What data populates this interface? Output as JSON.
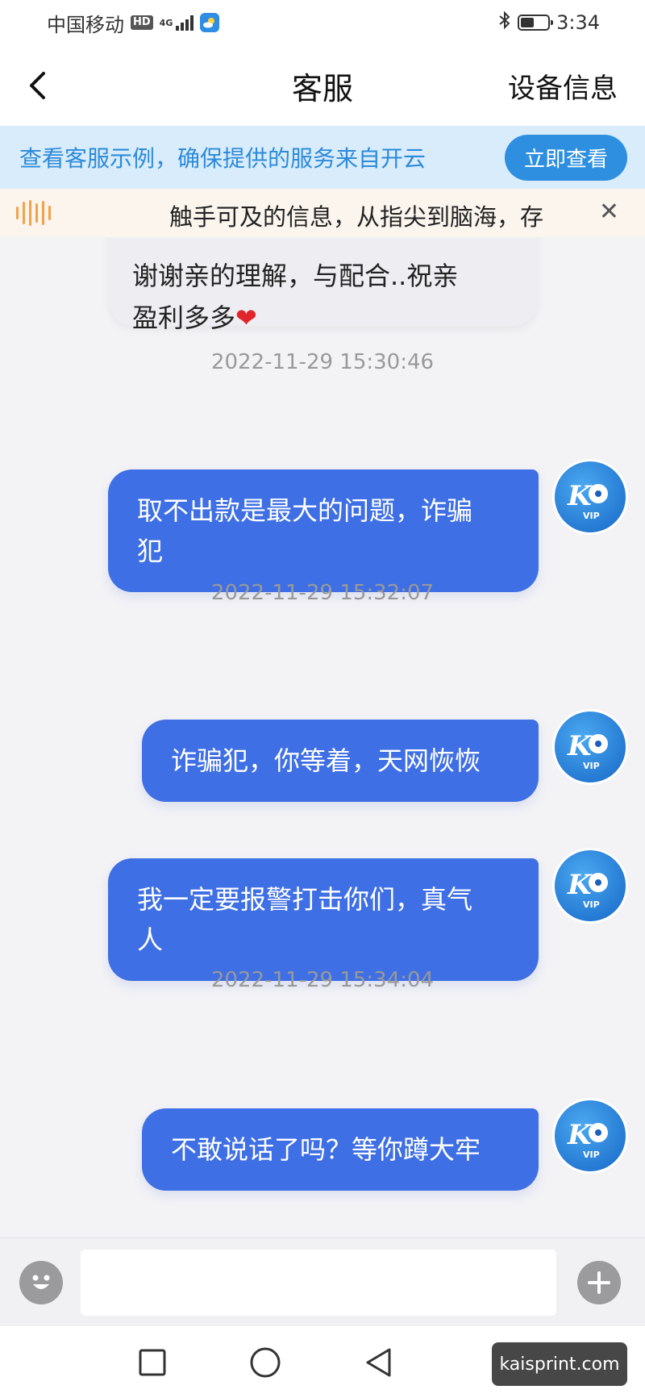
{
  "status_bar": {
    "carrier": "中国移动",
    "hd": "HD",
    "network": "4G",
    "time": "3:34",
    "battery_level": 0.5
  },
  "header": {
    "title": "客服",
    "action_label": "设备信息"
  },
  "notice": {
    "text": "查看客服示例，确保提供的服务来自开云",
    "button_label": "立即查看"
  },
  "marquee": {
    "text": "触手可及的信息，从指尖到脑海，存"
  },
  "messages": {
    "incoming": {
      "line1": "谢谢亲的理解，与配合..祝亲",
      "line2": "盈利多多",
      "heart": "❤"
    },
    "ts1": "2022-11-29 15:30:46",
    "m1_line1": "取不出款是最大的问题，诈骗",
    "m1_line2": "犯",
    "ts2": "2022-11-29 15:32:07",
    "m2": "诈骗犯，你等着，天网恢恢",
    "m3_line1": "我一定要报警打击你们，真气",
    "m3_line2": "人",
    "ts3": "2022-11-29 15:34:04",
    "m4": "不敢说话了吗？等你蹲大牢",
    "avatar_text": "VIP"
  },
  "input": {
    "placeholder": ""
  },
  "watermark": "kaisprint.com",
  "colors": {
    "accent": "#2e8fe0",
    "bubble_out": "#3f6fe4",
    "notice_bg": "#d8ecfb"
  }
}
